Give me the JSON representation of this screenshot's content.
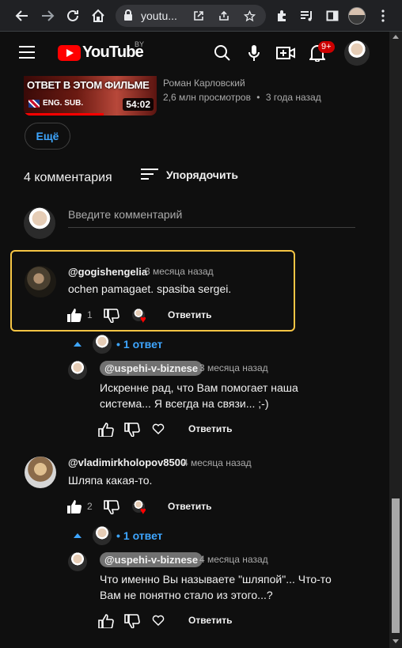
{
  "browser": {
    "url": "youtu...",
    "icons": [
      "back-icon",
      "forward-icon",
      "reload-icon",
      "home-icon",
      "lock-icon",
      "open-external-icon",
      "share-icon",
      "star-icon",
      "extensions-icon",
      "reading-list-icon",
      "side-panel-icon",
      "profile-avatar",
      "kebab-menu-icon"
    ]
  },
  "header": {
    "logo_text": "YouTube",
    "country_code": "BY",
    "notifications_badge": "9+"
  },
  "video": {
    "thumb_title": "ОТВЕТ В ЭТОМ ФИЛЬМЕ",
    "thumb_sub": "ENG. SUB.",
    "duration": "54:02",
    "channel": "Роман Карловский",
    "views": "2,6 млн просмотров",
    "age": "3 года назад"
  },
  "more_button": "Ещё",
  "comments_header": {
    "count": "4 комментария",
    "sort_label": "Упорядочить"
  },
  "comment_input": {
    "placeholder": "Введите комментарий"
  },
  "comments": [
    {
      "author": "@gogishengelia",
      "time": "3 месяца назад",
      "text": "ochen pamagaet. spasiba sergei.",
      "likes": "1",
      "reply": "Ответить",
      "replies_toggle": "1 ответ",
      "reply_item": {
        "author": "@uspehi-v-biznese",
        "time": "3 месяца назад",
        "text_line1": "Искренне рад, что Вам помогает наша",
        "text_line2": "система... Я всегда на связи... ;-)",
        "reply": "Ответить"
      }
    },
    {
      "author": "@vladimirkholopov8500",
      "time": "4 месяца назад",
      "text": "Шляпа какая-то.",
      "likes": "2",
      "reply": "Ответить",
      "replies_toggle": "1 ответ",
      "reply_item": {
        "author": "@uspehi-v-biznese",
        "time": "4 месяца назад",
        "text_line1": "Что именно Вы называете \"шляпой\"... Что-то",
        "text_line2": "Вам не понятно стало из этого...?",
        "reply": "Ответить"
      }
    }
  ],
  "colors": {
    "background": "#0f0f0f",
    "accent_blue": "#3ea6ff",
    "highlight_border": "#f6c544",
    "brand_red": "#ff0000"
  }
}
